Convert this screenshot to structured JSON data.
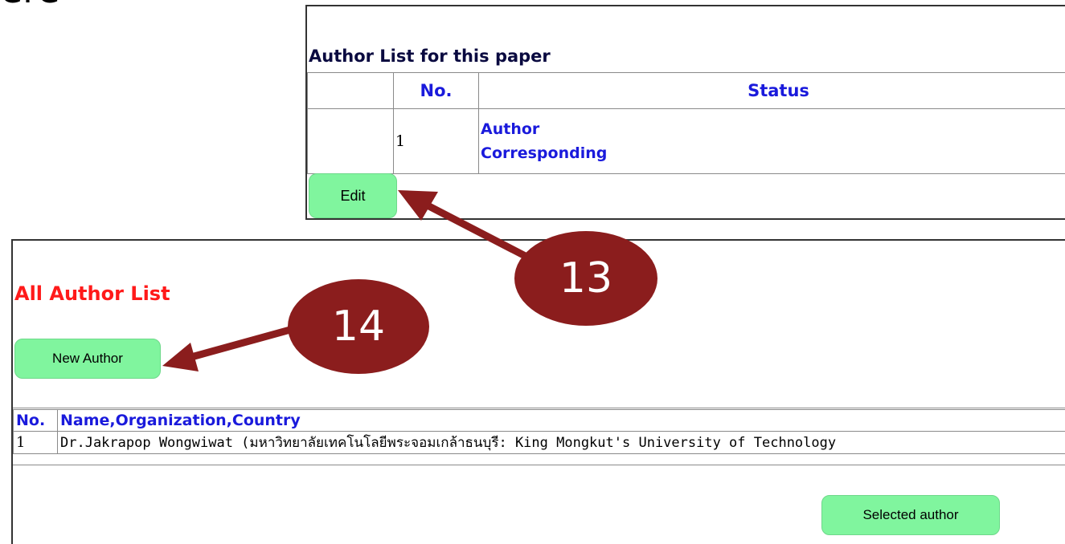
{
  "top_cut_text": "ere",
  "paper_authors": {
    "title": "Author List for this paper",
    "columns": [
      "",
      "No.",
      "Status"
    ],
    "rows": [
      {
        "no": "1",
        "status": [
          "Author",
          "Corresponding"
        ]
      }
    ],
    "edit_label": "Edit"
  },
  "all_authors": {
    "title": "All Author List",
    "new_author_label": "New Author",
    "columns": [
      "No.",
      "Name,Organization,Country"
    ],
    "rows": [
      {
        "no": "1",
        "name": "Dr.Jakrapop Wongwiwat (มหาวิทยาลัยเทคโนโลยีพระจอมเกล้าธนบุรี: King Mongkut's University of Technology"
      }
    ],
    "selected_label": "Selected  author"
  },
  "annotations": [
    {
      "label": "13",
      "target": "edit-button"
    },
    {
      "label": "14",
      "target": "new-author-button"
    }
  ],
  "colors": {
    "button_green": "#80f59e",
    "callout_red": "#8b1d1d",
    "header_blue": "#1a1adc",
    "title_red": "#ff1a1a"
  }
}
